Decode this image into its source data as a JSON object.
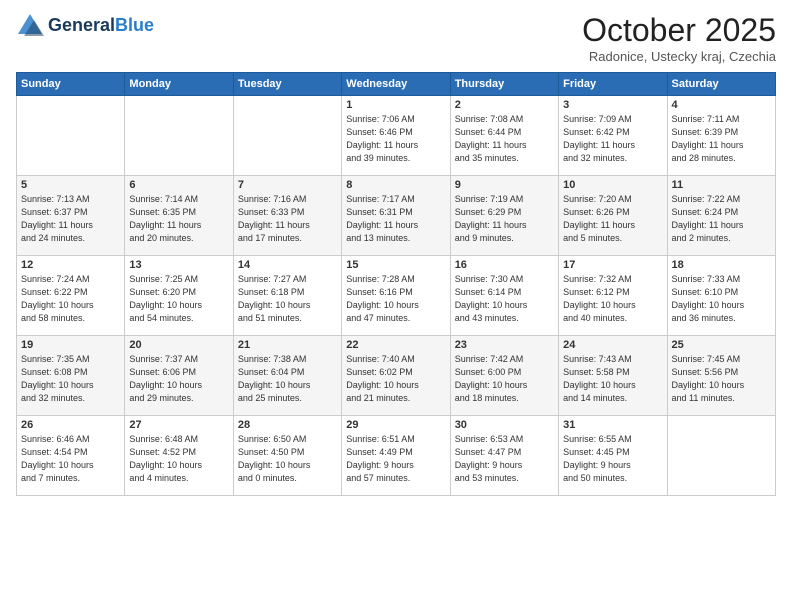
{
  "header": {
    "logo_general": "General",
    "logo_blue": "Blue",
    "month_title": "October 2025",
    "location": "Radonice, Ustecky kraj, Czechia"
  },
  "days_of_week": [
    "Sunday",
    "Monday",
    "Tuesday",
    "Wednesday",
    "Thursday",
    "Friday",
    "Saturday"
  ],
  "weeks": [
    [
      {
        "day": "",
        "info": ""
      },
      {
        "day": "",
        "info": ""
      },
      {
        "day": "",
        "info": ""
      },
      {
        "day": "1",
        "info": "Sunrise: 7:06 AM\nSunset: 6:46 PM\nDaylight: 11 hours\nand 39 minutes."
      },
      {
        "day": "2",
        "info": "Sunrise: 7:08 AM\nSunset: 6:44 PM\nDaylight: 11 hours\nand 35 minutes."
      },
      {
        "day": "3",
        "info": "Sunrise: 7:09 AM\nSunset: 6:42 PM\nDaylight: 11 hours\nand 32 minutes."
      },
      {
        "day": "4",
        "info": "Sunrise: 7:11 AM\nSunset: 6:39 PM\nDaylight: 11 hours\nand 28 minutes."
      }
    ],
    [
      {
        "day": "5",
        "info": "Sunrise: 7:13 AM\nSunset: 6:37 PM\nDaylight: 11 hours\nand 24 minutes."
      },
      {
        "day": "6",
        "info": "Sunrise: 7:14 AM\nSunset: 6:35 PM\nDaylight: 11 hours\nand 20 minutes."
      },
      {
        "day": "7",
        "info": "Sunrise: 7:16 AM\nSunset: 6:33 PM\nDaylight: 11 hours\nand 17 minutes."
      },
      {
        "day": "8",
        "info": "Sunrise: 7:17 AM\nSunset: 6:31 PM\nDaylight: 11 hours\nand 13 minutes."
      },
      {
        "day": "9",
        "info": "Sunrise: 7:19 AM\nSunset: 6:29 PM\nDaylight: 11 hours\nand 9 minutes."
      },
      {
        "day": "10",
        "info": "Sunrise: 7:20 AM\nSunset: 6:26 PM\nDaylight: 11 hours\nand 5 minutes."
      },
      {
        "day": "11",
        "info": "Sunrise: 7:22 AM\nSunset: 6:24 PM\nDaylight: 11 hours\nand 2 minutes."
      }
    ],
    [
      {
        "day": "12",
        "info": "Sunrise: 7:24 AM\nSunset: 6:22 PM\nDaylight: 10 hours\nand 58 minutes."
      },
      {
        "day": "13",
        "info": "Sunrise: 7:25 AM\nSunset: 6:20 PM\nDaylight: 10 hours\nand 54 minutes."
      },
      {
        "day": "14",
        "info": "Sunrise: 7:27 AM\nSunset: 6:18 PM\nDaylight: 10 hours\nand 51 minutes."
      },
      {
        "day": "15",
        "info": "Sunrise: 7:28 AM\nSunset: 6:16 PM\nDaylight: 10 hours\nand 47 minutes."
      },
      {
        "day": "16",
        "info": "Sunrise: 7:30 AM\nSunset: 6:14 PM\nDaylight: 10 hours\nand 43 minutes."
      },
      {
        "day": "17",
        "info": "Sunrise: 7:32 AM\nSunset: 6:12 PM\nDaylight: 10 hours\nand 40 minutes."
      },
      {
        "day": "18",
        "info": "Sunrise: 7:33 AM\nSunset: 6:10 PM\nDaylight: 10 hours\nand 36 minutes."
      }
    ],
    [
      {
        "day": "19",
        "info": "Sunrise: 7:35 AM\nSunset: 6:08 PM\nDaylight: 10 hours\nand 32 minutes."
      },
      {
        "day": "20",
        "info": "Sunrise: 7:37 AM\nSunset: 6:06 PM\nDaylight: 10 hours\nand 29 minutes."
      },
      {
        "day": "21",
        "info": "Sunrise: 7:38 AM\nSunset: 6:04 PM\nDaylight: 10 hours\nand 25 minutes."
      },
      {
        "day": "22",
        "info": "Sunrise: 7:40 AM\nSunset: 6:02 PM\nDaylight: 10 hours\nand 21 minutes."
      },
      {
        "day": "23",
        "info": "Sunrise: 7:42 AM\nSunset: 6:00 PM\nDaylight: 10 hours\nand 18 minutes."
      },
      {
        "day": "24",
        "info": "Sunrise: 7:43 AM\nSunset: 5:58 PM\nDaylight: 10 hours\nand 14 minutes."
      },
      {
        "day": "25",
        "info": "Sunrise: 7:45 AM\nSunset: 5:56 PM\nDaylight: 10 hours\nand 11 minutes."
      }
    ],
    [
      {
        "day": "26",
        "info": "Sunrise: 6:46 AM\nSunset: 4:54 PM\nDaylight: 10 hours\nand 7 minutes."
      },
      {
        "day": "27",
        "info": "Sunrise: 6:48 AM\nSunset: 4:52 PM\nDaylight: 10 hours\nand 4 minutes."
      },
      {
        "day": "28",
        "info": "Sunrise: 6:50 AM\nSunset: 4:50 PM\nDaylight: 10 hours\nand 0 minutes."
      },
      {
        "day": "29",
        "info": "Sunrise: 6:51 AM\nSunset: 4:49 PM\nDaylight: 9 hours\nand 57 minutes."
      },
      {
        "day": "30",
        "info": "Sunrise: 6:53 AM\nSunset: 4:47 PM\nDaylight: 9 hours\nand 53 minutes."
      },
      {
        "day": "31",
        "info": "Sunrise: 6:55 AM\nSunset: 4:45 PM\nDaylight: 9 hours\nand 50 minutes."
      },
      {
        "day": "",
        "info": ""
      }
    ]
  ]
}
